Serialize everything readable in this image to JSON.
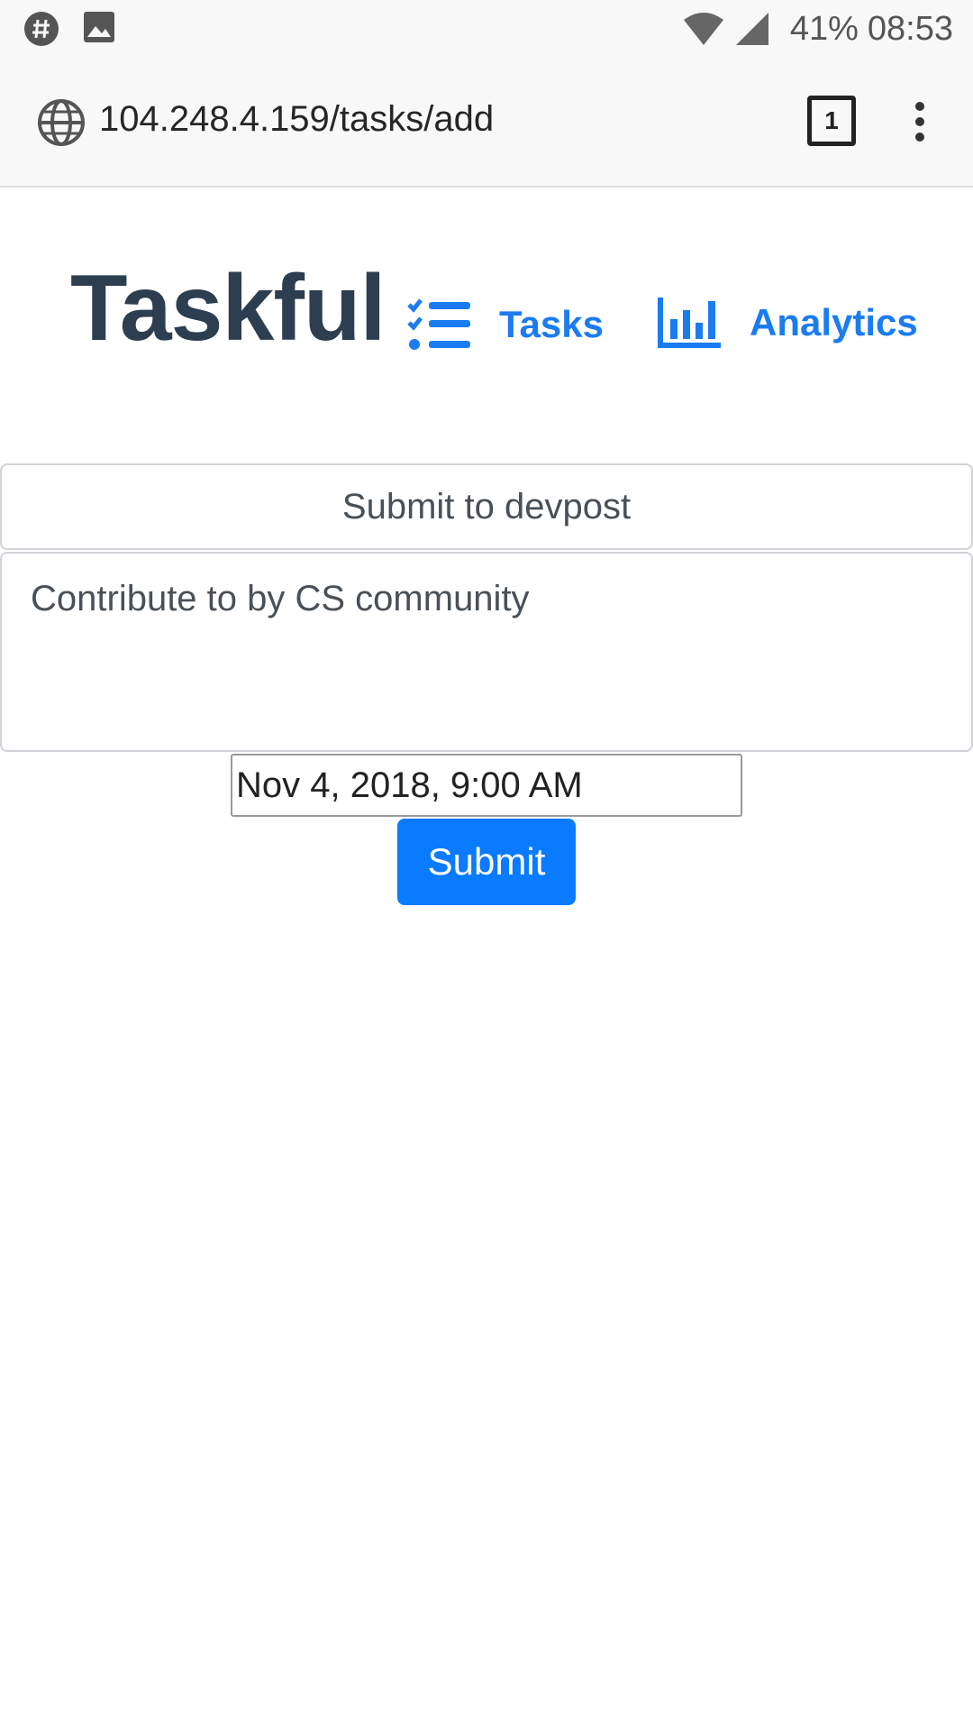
{
  "status_bar": {
    "battery": "41%",
    "time": "08:53",
    "left_icons": [
      "hashtag-app-icon",
      "image-notification-icon"
    ],
    "right_icons": [
      "wifi-icon",
      "cell-signal-icon"
    ]
  },
  "browser": {
    "url": "104.248.4.159/tasks/add",
    "tab_count": "1",
    "icons": [
      "globe-icon",
      "tabs-icon",
      "overflow-menu-icon"
    ]
  },
  "header": {
    "brand": "Taskful",
    "nav": {
      "tasks_label": "Tasks",
      "tasks_icon": "checklist-icon",
      "analytics_label": "Analytics",
      "analytics_icon": "bar-chart-icon"
    },
    "link_color": "#1a7cf0",
    "brand_color": "#2c3e50"
  },
  "form": {
    "title_value": "Submit to devpost",
    "description_value": "Contribute to by CS community",
    "datetime_value": "Nov 4, 2018, 9:00 AM",
    "submit_label": "Submit",
    "submit_color": "#0a7bff"
  }
}
